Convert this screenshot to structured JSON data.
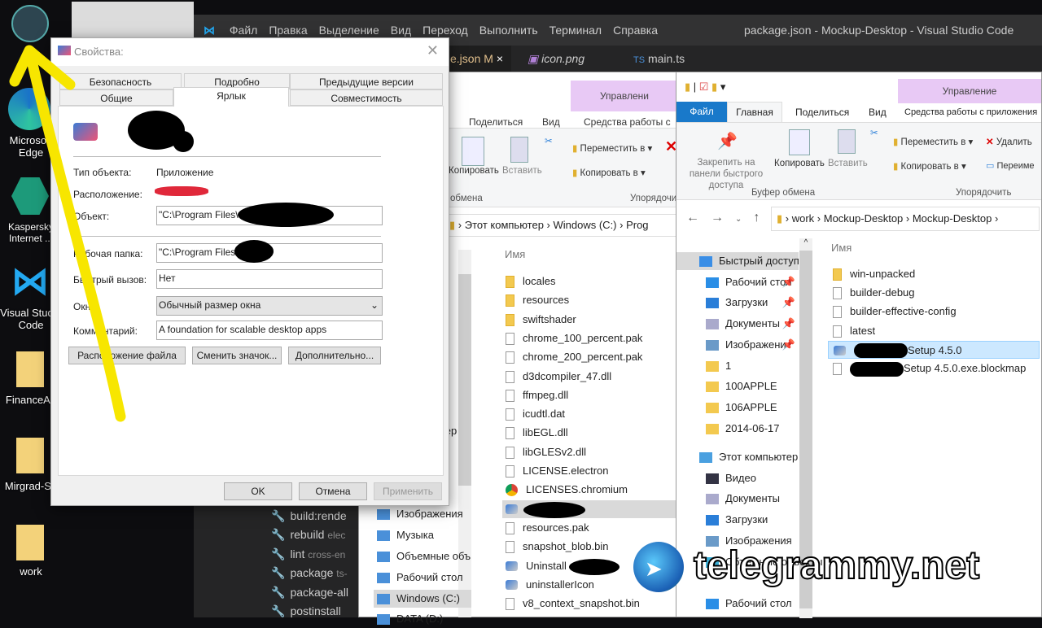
{
  "desktop": {
    "icons": [
      {
        "label": "",
        "name": "electron-shortcut"
      },
      {
        "label": "Microsoft Edge",
        "name": "edge-shortcut"
      },
      {
        "label": "Kaspersky Internet ...",
        "name": "kaspersky-shortcut"
      },
      {
        "label": "Visual Studio Code",
        "name": "vscode-shortcut"
      },
      {
        "label": "FinanceAp",
        "name": "financeapp-folder"
      },
      {
        "label": "Mirgrad-Se",
        "name": "mirgrad-folder"
      },
      {
        "label": "work",
        "name": "work-folder"
      }
    ]
  },
  "vscode": {
    "menu": [
      "Файл",
      "Правка",
      "Выделение",
      "Вид",
      "Переход",
      "Выполнить",
      "Терминал",
      "Справка"
    ],
    "title": "package.json - Mockup-Desktop - Visual Studio Code",
    "tabs": [
      {
        "label": "e.json",
        "badge": "M",
        "close": "×"
      },
      {
        "label": "icon.png"
      },
      {
        "label": "main.ts",
        "prefix": "TS"
      }
    ],
    "scripts": [
      {
        "name": "build:rende",
        "cmd": ""
      },
      {
        "name": "rebuild",
        "cmd": "elec"
      },
      {
        "name": "lint",
        "cmd": "cross-en"
      },
      {
        "name": "package",
        "cmd": "ts-"
      },
      {
        "name": "package-all",
        "cmd": ""
      },
      {
        "name": "postinstall",
        "cmd": ""
      }
    ]
  },
  "explorer_mid": {
    "manage_label": "Управлени",
    "tabs": [
      "Поделиться",
      "Вид",
      "Средства работы с пр"
    ],
    "ribbon": {
      "copy": "Копировать",
      "paste": "Вставить",
      "move_to": "Переместить в",
      "copy_to": "Копировать в",
      "clipboard_group": "обмена",
      "organize_group": "Упорядочи"
    },
    "breadcrumb": [
      "Этот компьютер",
      "Windows (C:)",
      "Prog"
    ],
    "column_name": "Имя",
    "nav": [
      {
        "label": "тер"
      },
      {
        "label": "Изображения"
      },
      {
        "label": "Музыка"
      },
      {
        "label": "Объемные объ"
      },
      {
        "label": "Рабочий стол"
      },
      {
        "label": "Windows (C:)",
        "selected": true
      },
      {
        "label": "DATA (D:)"
      }
    ],
    "files": [
      {
        "name": "locales",
        "type": "folder"
      },
      {
        "name": "resources",
        "type": "folder"
      },
      {
        "name": "swiftshader",
        "type": "folder"
      },
      {
        "name": "chrome_100_percent.pak",
        "type": "file"
      },
      {
        "name": "chrome_200_percent.pak",
        "type": "file"
      },
      {
        "name": "d3dcompiler_47.dll",
        "type": "dll"
      },
      {
        "name": "ffmpeg.dll",
        "type": "dll"
      },
      {
        "name": "icudtl.dat",
        "type": "file"
      },
      {
        "name": "libEGL.dll",
        "type": "dll"
      },
      {
        "name": "libGLESv2.dll",
        "type": "dll"
      },
      {
        "name": "LICENSE.electron",
        "type": "text"
      },
      {
        "name": "LICENSES.chromium",
        "type": "chrome"
      },
      {
        "name": "",
        "type": "app",
        "selected": true
      },
      {
        "name": "resources.pak",
        "type": "file"
      },
      {
        "name": "snapshot_blob.bin",
        "type": "file"
      },
      {
        "name": "Uninstall",
        "type": "app"
      },
      {
        "name": "uninstallerIcon",
        "type": "app"
      },
      {
        "name": "v8_context_snapshot.bin",
        "type": "file"
      }
    ]
  },
  "explorer_right": {
    "manage_label": "Управление",
    "tabs": [
      "Файл",
      "Главная",
      "Поделиться",
      "Вид",
      "Средства работы с приложения"
    ],
    "ribbon": {
      "pin": "Закрепить на панели быстрого доступа",
      "copy": "Копировать",
      "paste": "Вставить",
      "move_to": "Переместить в",
      "copy_to": "Копировать в",
      "delete": "Удалить",
      "rename": "Переиме",
      "clipboard_group": "Буфер обмена",
      "organize_group": "Упорядочить"
    },
    "breadcrumb": [
      "work",
      "Mockup-Desktop",
      "Mockup-Desktop"
    ],
    "column_name": "Имя",
    "nav": [
      {
        "label": "Быстрый доступ",
        "icon": "star",
        "selected": true
      },
      {
        "label": "Рабочий стол",
        "icon": "desktop",
        "pin": true
      },
      {
        "label": "Загрузки",
        "icon": "download",
        "pin": true
      },
      {
        "label": "Документы",
        "icon": "docs",
        "pin": true
      },
      {
        "label": "Изображени",
        "icon": "pictures",
        "pin": true
      },
      {
        "label": "1",
        "icon": "folder"
      },
      {
        "label": "100APPLE",
        "icon": "folder"
      },
      {
        "label": "106APPLE",
        "icon": "folder"
      },
      {
        "label": "2014-06-17",
        "icon": "folder"
      },
      {
        "label": "Этот компьютер",
        "icon": "pc"
      },
      {
        "label": "Видео",
        "icon": "video"
      },
      {
        "label": "Документы",
        "icon": "docs"
      },
      {
        "label": "Загрузки",
        "icon": "download"
      },
      {
        "label": "Изображения",
        "icon": "pictures"
      },
      {
        "label": "Объемные объекты",
        "icon": "3d"
      },
      {
        "label": "Рабочий стол",
        "icon": "desktop"
      }
    ],
    "files": [
      {
        "name": "win-unpacked",
        "type": "folder"
      },
      {
        "name": "builder-debug",
        "type": "file"
      },
      {
        "name": "builder-effective-config",
        "type": "file"
      },
      {
        "name": "latest",
        "type": "file"
      },
      {
        "name": "Setup 4.5.0",
        "type": "app",
        "selected": true
      },
      {
        "name": "Setup 4.5.0.exe.blockmap",
        "type": "file"
      }
    ]
  },
  "dialog": {
    "title": "Свойства:",
    "tabs_back": [
      "Безопасность",
      "Подробно",
      "Предыдущие версии"
    ],
    "tabs_front": [
      "Общие",
      "Ярлык",
      "Совместимость"
    ],
    "active_tab": "Ярлык",
    "fields": {
      "type_label": "Тип объекта:",
      "type_value": "Приложение",
      "location_label": "Расположение:",
      "target_label": "Объект:",
      "target_value": "\"C:\\Program Files\\                              s.exe\"",
      "workdir_label": "Рабочая папка:",
      "workdir_value": "\"C:\\Program Files          cs\"",
      "hotkey_label": "Быстрый вызов:",
      "hotkey_value": "Нет",
      "window_label": "Окно:",
      "window_value": "Обычный размер окна",
      "comment_label": "Комментарий:",
      "comment_value": "A foundation for scalable desktop apps"
    },
    "buttons": {
      "open_location": "Расположение файла",
      "change_icon": "Сменить значок...",
      "advanced": "Дополнительно...",
      "ok": "OK",
      "cancel": "Отмена",
      "apply": "Применить"
    }
  },
  "watermark": "telegrammy.net"
}
